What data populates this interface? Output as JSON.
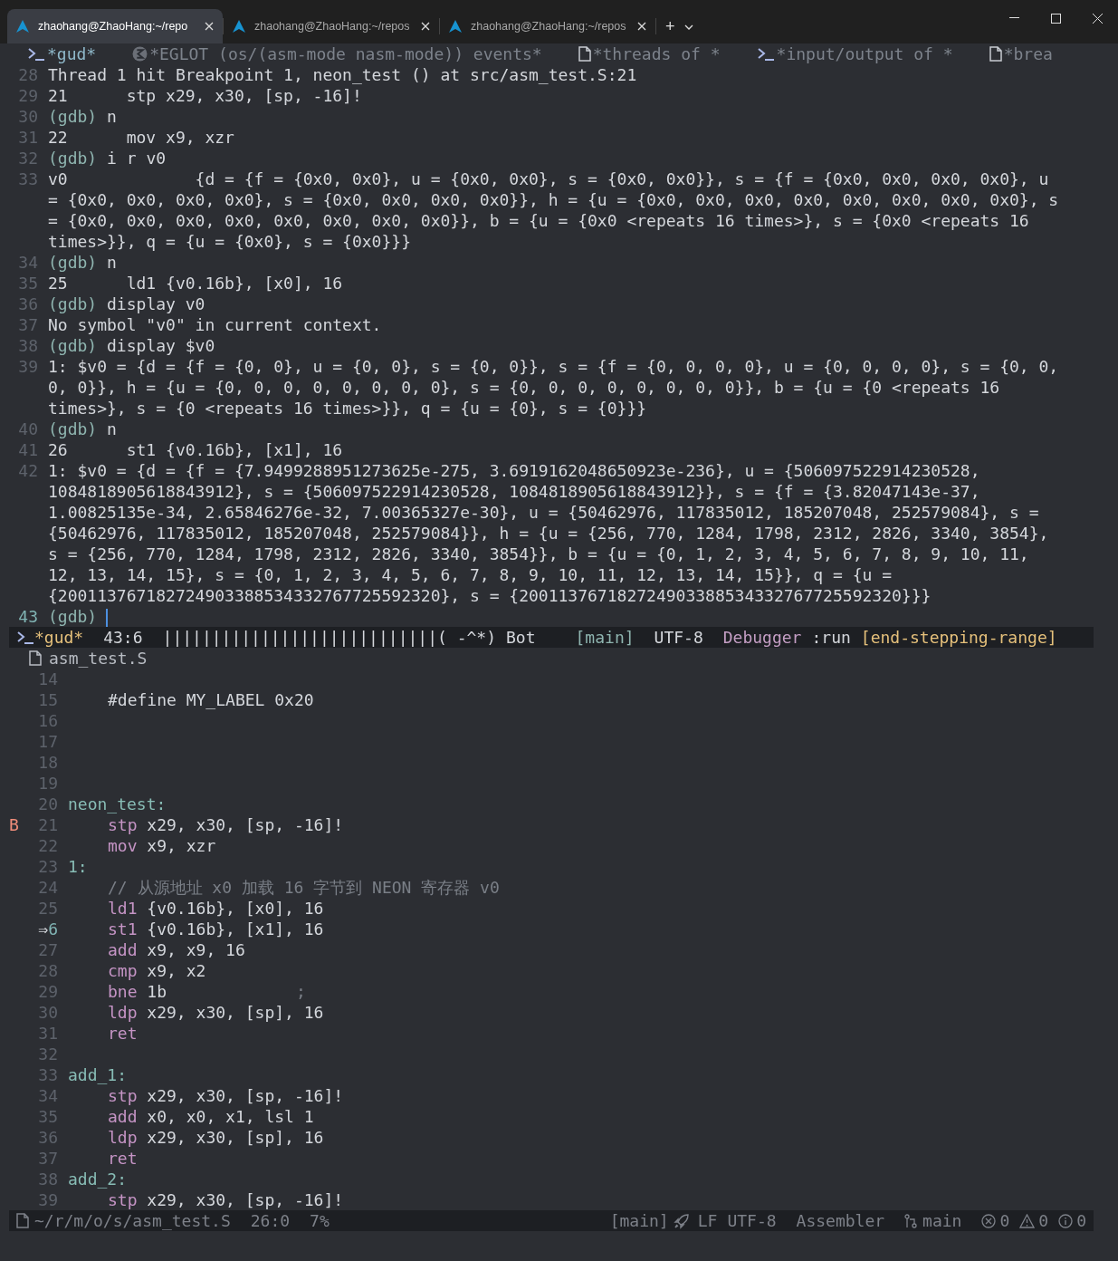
{
  "titlebar": {
    "tabs": [
      {
        "title": "zhaohang@ZhaoHang:~/repo",
        "selected": true
      },
      {
        "title": "zhaohang@ZhaoHang:~/repos",
        "selected": false
      },
      {
        "title": "zhaohang@ZhaoHang:~/repos",
        "selected": false
      }
    ],
    "new_tab": "+"
  },
  "header_tabs": [
    {
      "kind": "terminal",
      "label": "*gud*",
      "selected": true
    },
    {
      "kind": "emacs",
      "label": "*EGLOT (os/(asm-mode nasm-mode)) events*",
      "selected": false
    },
    {
      "kind": "file",
      "label": "*threads of *",
      "selected": false
    },
    {
      "kind": "terminal",
      "label": "*input/output of *",
      "selected": false
    },
    {
      "kind": "file",
      "label": "*brea",
      "selected": false
    }
  ],
  "gdb_lines": [
    {
      "num": "28",
      "current": false,
      "lines": [
        "Thread 1 hit Breakpoint 1, neon_test () at src/asm_test.S:21"
      ]
    },
    {
      "num": "29",
      "current": false,
      "lines": [
        "21      stp x29, x30, [sp, -16]!"
      ]
    },
    {
      "num": "30",
      "current": false,
      "prompt": "(gdb)",
      "command": "n"
    },
    {
      "num": "31",
      "current": false,
      "lines": [
        "22      mov x9, xzr"
      ]
    },
    {
      "num": "32",
      "current": false,
      "prompt": "(gdb)",
      "command": "i r v0"
    },
    {
      "num": "33",
      "current": false,
      "lines": [
        "v0             {d = {f = {0x0, 0x0}, u = {0x0, 0x0}, s = {0x0, 0x0}}, s = {f = {0x0, 0x0, 0x0, 0x0}, u",
        "= {0x0, 0x0, 0x0, 0x0}, s = {0x0, 0x0, 0x0, 0x0}}, h = {u = {0x0, 0x0, 0x0, 0x0, 0x0, 0x0, 0x0, 0x0}, s",
        "= {0x0, 0x0, 0x0, 0x0, 0x0, 0x0, 0x0, 0x0}}, b = {u = {0x0 <repeats 16 times>}, s = {0x0 <repeats 16",
        "times>}}, q = {u = {0x0}, s = {0x0}}}"
      ]
    },
    {
      "num": "34",
      "current": false,
      "prompt": "(gdb)",
      "command": "n"
    },
    {
      "num": "35",
      "current": false,
      "lines": [
        "25      ld1 {v0.16b}, [x0], 16"
      ]
    },
    {
      "num": "36",
      "current": false,
      "prompt": "(gdb)",
      "command": "display v0"
    },
    {
      "num": "37",
      "current": false,
      "lines": [
        "No symbol \"v0\" in current context."
      ]
    },
    {
      "num": "38",
      "current": false,
      "prompt": "(gdb)",
      "command": "display $v0"
    },
    {
      "num": "39",
      "current": false,
      "lines": [
        "1: $v0 = {d = {f = {0, 0}, u = {0, 0}, s = {0, 0}}, s = {f = {0, 0, 0, 0}, u = {0, 0, 0, 0}, s = {0, 0,",
        "0, 0}}, h = {u = {0, 0, 0, 0, 0, 0, 0, 0}, s = {0, 0, 0, 0, 0, 0, 0, 0}}, b = {u = {0 <repeats 16",
        "times>}, s = {0 <repeats 16 times>}}, q = {u = {0}, s = {0}}}"
      ]
    },
    {
      "num": "40",
      "current": false,
      "prompt": "(gdb)",
      "command": "n"
    },
    {
      "num": "41",
      "current": false,
      "lines": [
        "26      st1 {v0.16b}, [x1], 16"
      ]
    },
    {
      "num": "42",
      "current": false,
      "lines": [
        "1: $v0 = {d = {f = {7.9499288951273625e-275, 3.6919162048650923e-236}, u = {506097522914230528,",
        "1084818905618843912}, s = {506097522914230528, 1084818905618843912}}, s = {f = {3.82047143e-37,",
        "1.00825135e-34, 2.65846276e-32, 7.00365327e-30}, u = {50462976, 117835012, 185207048, 252579084}, s =",
        "{50462976, 117835012, 185207048, 252579084}}, h = {u = {256, 770, 1284, 1798, 2312, 2826, 3340, 3854},",
        "s = {256, 770, 1284, 1798, 2312, 2826, 3340, 3854}}, b = {u = {0, 1, 2, 3, 4, 5, 6, 7, 8, 9, 10, 11,",
        "12, 13, 14, 15}, s = {0, 1, 2, 3, 4, 5, 6, 7, 8, 9, 10, 11, 12, 13, 14, 15}}, q = {u =",
        "{200113767182724903388534332767725592320}, s = {200113767182724903388534332767725592320}}}"
      ]
    },
    {
      "num": "43",
      "current": true,
      "prompt": "(gdb)"
    }
  ],
  "gud_mode_line": {
    "buffer": "*gud*",
    "position": "43:6",
    "bar": "||||||||||||||||||||||||||||",
    "mascot": "( -^*)",
    "scroll": "Bot",
    "branch": "[main]",
    "encoding": "UTF-8",
    "mode": "Debugger",
    "status": ":run",
    "state": "[end-stepping-range]"
  },
  "source_header": {
    "file": "asm_test.S"
  },
  "source_lines": [
    {
      "num": "14",
      "kind": "blank"
    },
    {
      "num": "15",
      "kind": "directive",
      "text": "#define MY_LABEL 0x20"
    },
    {
      "num": "16",
      "kind": "blank"
    },
    {
      "num": "17",
      "kind": "blank"
    },
    {
      "num": "18",
      "kind": "blank"
    },
    {
      "num": "19",
      "kind": "blank"
    },
    {
      "num": "20",
      "kind": "label",
      "text": "neon_test:"
    },
    {
      "num": "21",
      "kind": "instruction",
      "op": "stp",
      "args": "x29, x30, [sp, -16]!",
      "fringe": "B"
    },
    {
      "num": "22",
      "kind": "instruction",
      "op": "mov",
      "args": "x9, xzr"
    },
    {
      "num": "23",
      "kind": "label",
      "text": "1:"
    },
    {
      "num": "24",
      "kind": "comment",
      "text": "// 从源地址 x0 加载 16 字节到 NEON 寄存器 v0"
    },
    {
      "num": "25",
      "kind": "instruction",
      "op": "ld1",
      "args": "{v0.16b}, [x0], 16"
    },
    {
      "num": "6",
      "kind": "instruction",
      "op": "st1",
      "args": "{v0.16b}, [x1], 16",
      "arrow": "⇒"
    },
    {
      "num": "27",
      "kind": "instruction",
      "op": "add",
      "args": "x9, x9, 16"
    },
    {
      "num": "28",
      "kind": "instruction",
      "op": "cmp",
      "args": "x9, x2"
    },
    {
      "num": "29",
      "kind": "instruction",
      "op": "bne",
      "args": "1b",
      "trailing": ";"
    },
    {
      "num": "30",
      "kind": "instruction",
      "op": "ldp",
      "args": "x29, x30, [sp], 16"
    },
    {
      "num": "31",
      "kind": "instruction",
      "op": "ret"
    },
    {
      "num": "32",
      "kind": "blank"
    },
    {
      "num": "33",
      "kind": "label",
      "text": "add_1:"
    },
    {
      "num": "34",
      "kind": "instruction",
      "op": "stp",
      "args": "x29, x30, [sp, -16]!"
    },
    {
      "num": "35",
      "kind": "instruction",
      "op": "add",
      "args": "x0, x0, x1, lsl 1"
    },
    {
      "num": "36",
      "kind": "instruction",
      "op": "ldp",
      "args": "x29, x30, [sp], 16"
    },
    {
      "num": "37",
      "kind": "instruction",
      "op": "ret"
    },
    {
      "num": "38",
      "kind": "label",
      "text": "add_2:"
    },
    {
      "num": "39",
      "kind": "instruction",
      "op": "stp",
      "args": "x29, x30, [sp, -16]!"
    }
  ],
  "source_mode_line": {
    "path": "~/r/m/o/s/asm_test.S",
    "position": "26:0",
    "percent": "7%",
    "branch": "[main]",
    "eol": "LF",
    "encoding": "UTF-8",
    "mode": "Assembler",
    "vc_branch": "main",
    "errors": "0",
    "warnings": "0",
    "infos": "0"
  }
}
